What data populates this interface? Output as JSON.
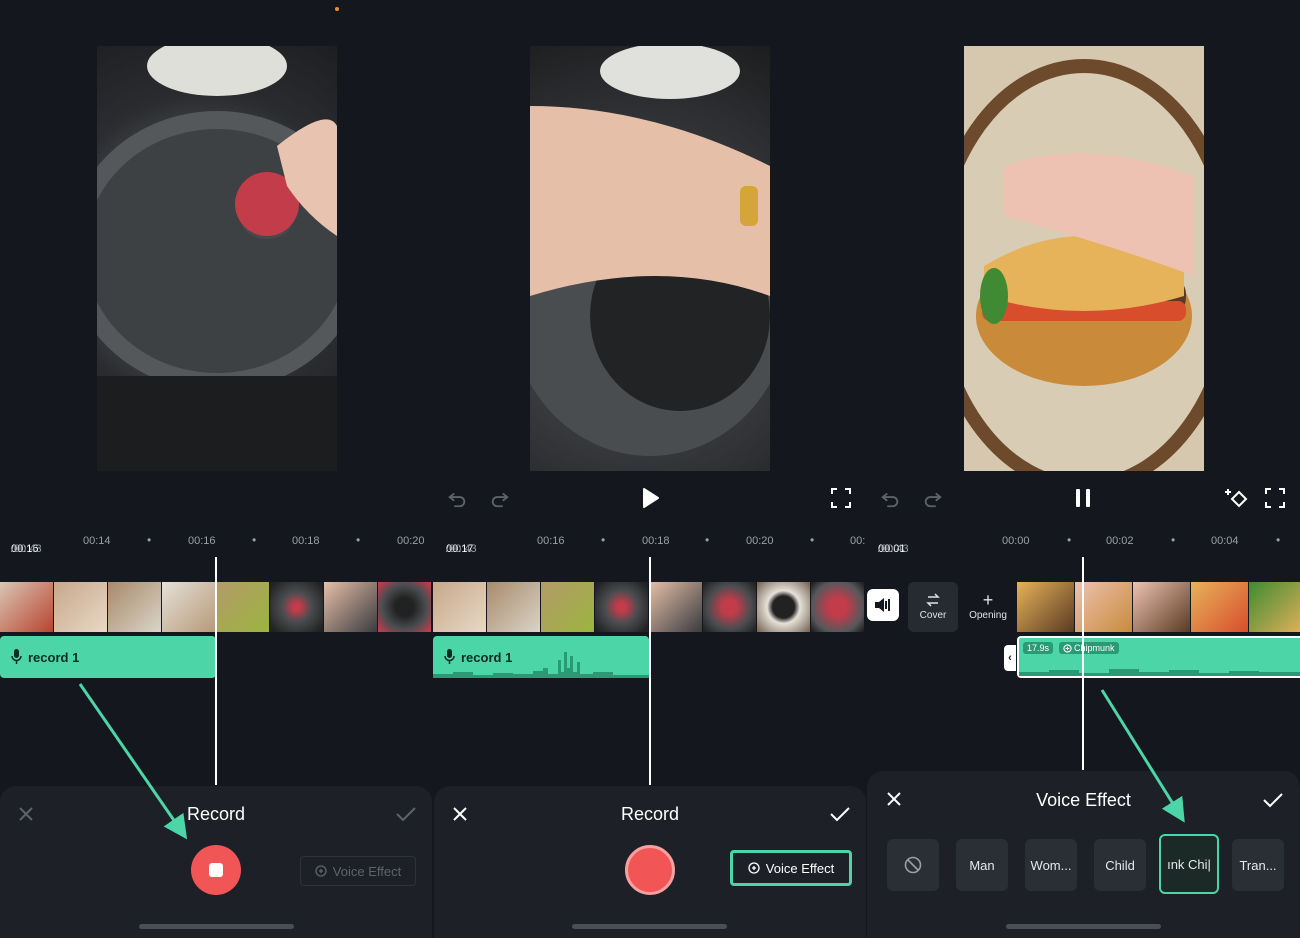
{
  "colors": {
    "accent": "#4cd6a7",
    "record": "#f25555",
    "background": "#14171d",
    "panel": "#1d2026"
  },
  "panel1": {
    "time_current": "00:16",
    "time_total": "/00:43",
    "ticks": [
      "00:14",
      "00:16",
      "00:18",
      "00:20"
    ],
    "track_label": "record 1",
    "title": "Record",
    "voice_effect_label": "Voice Effect"
  },
  "panel2": {
    "time_current": "00:17",
    "time_total": "/00:43",
    "ticks": [
      "00:16",
      "00:18",
      "00:20",
      "00:"
    ],
    "track_label": "record 1",
    "title": "Record",
    "voice_effect_label": "Voice Effect"
  },
  "panel3": {
    "time_current": "00:01",
    "time_total": "/00:43",
    "ticks": [
      "00:00",
      "00:02",
      "00:04"
    ],
    "cover_label": "Cover",
    "opening_label": "Opening",
    "clip_duration": "17.9s",
    "clip_effect": "Chipmunk",
    "title": "Voice Effect",
    "effects": [
      "Man",
      "Wom...",
      "Child",
      "ınk Chi|",
      "Tran..."
    ]
  },
  "icons": {
    "undo": "undo-icon",
    "redo": "redo-icon",
    "play": "play-icon",
    "pause": "pause-icon",
    "fullscreen": "fullscreen-icon",
    "close": "close-icon",
    "check": "check-icon",
    "mic": "mic-icon",
    "voice": "voice-effect-icon",
    "none": "none-icon",
    "volume": "volume-icon",
    "keyframe": "keyframe-add-icon"
  }
}
